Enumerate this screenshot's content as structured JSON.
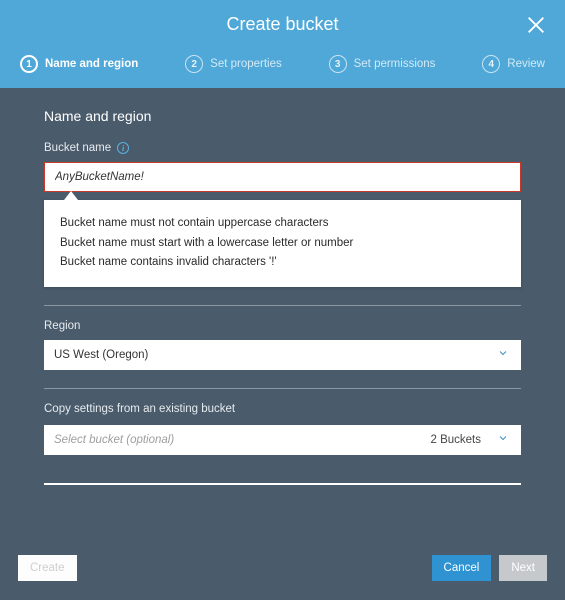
{
  "header": {
    "title": "Create bucket"
  },
  "steps": [
    {
      "num": "1",
      "label": "Name and region",
      "active": true
    },
    {
      "num": "2",
      "label": "Set properties",
      "active": false
    },
    {
      "num": "3",
      "label": "Set permissions",
      "active": false
    },
    {
      "num": "4",
      "label": "Review",
      "active": false
    }
  ],
  "section": {
    "title": "Name and region"
  },
  "bucketName": {
    "label": "Bucket name",
    "value": "AnyBucketName!",
    "errors": [
      "Bucket name must not contain uppercase characters",
      "Bucket name must start with a lowercase letter or number",
      "Bucket name contains invalid characters '!'"
    ]
  },
  "region": {
    "label": "Region",
    "value": "US West (Oregon)"
  },
  "copy": {
    "label": "Copy settings from an existing bucket",
    "placeholder": "Select bucket (optional)",
    "count": "2 Buckets"
  },
  "footer": {
    "create": "Create",
    "cancel": "Cancel",
    "next": "Next"
  }
}
